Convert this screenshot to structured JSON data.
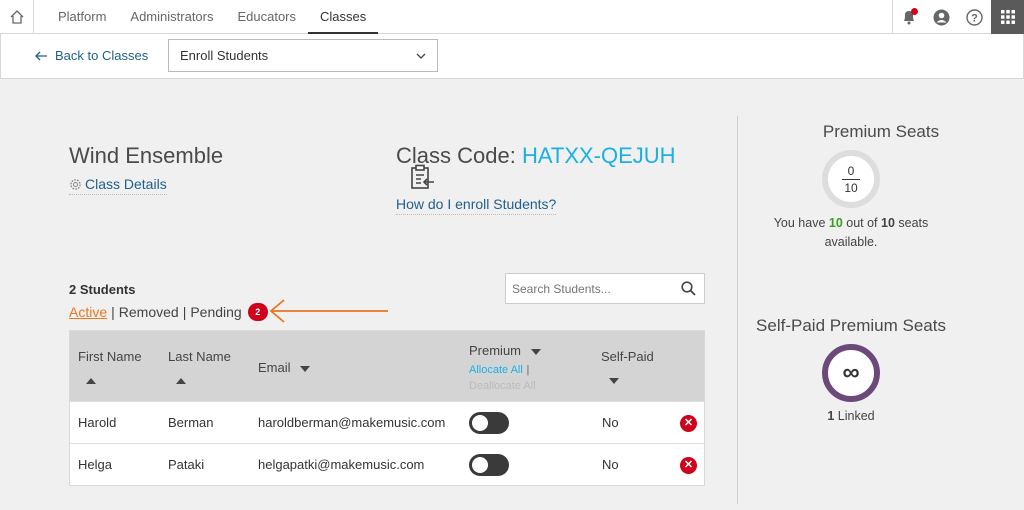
{
  "nav": {
    "tabs": [
      "Platform",
      "Administrators",
      "Educators",
      "Classes"
    ],
    "active_tab": "Classes",
    "icons": [
      "home-icon",
      "bell-icon",
      "account-icon",
      "help-icon",
      "apps-grid-icon"
    ]
  },
  "subbar": {
    "back_label": "Back to Classes",
    "select_value": "Enroll Students"
  },
  "class": {
    "name": "Wind Ensemble",
    "details_label": "Class Details",
    "code_label": "Class Code: ",
    "code": "HATXX-QEJUH",
    "howto": "How do I enroll Students?"
  },
  "students": {
    "count": "2 Students",
    "filter_active": "Active",
    "filter_removed": "Removed",
    "filter_pending": "Pending",
    "pending_count": "2",
    "sep": "|",
    "search_placeholder": "Search Students..."
  },
  "table": {
    "headers": {
      "first": "First Name",
      "last": "Last Name",
      "email": "Email",
      "premium": "Premium",
      "allocate": "Allocate All",
      "deallocate": "Deallocate All",
      "selfpaid": "Self-Paid"
    },
    "rows": [
      {
        "first": "Harold",
        "last": "Berman",
        "email": "haroldberman@makemusic.com",
        "premium": false,
        "selfpaid": "No"
      },
      {
        "first": "Helga",
        "last": "Pataki",
        "email": "helgapatki@makemusic.com",
        "premium": false,
        "selfpaid": "No"
      }
    ]
  },
  "seats": {
    "title": "Premium Seats",
    "used": "0",
    "total": "10",
    "text_pre": "You have ",
    "available": "10",
    "text_mid": " out of ",
    "of_total": "10",
    "text_post": " seats available.",
    "self_title": "Self-Paid Premium Seats",
    "self_symbol": "∞",
    "linked_count": "1",
    "linked_label": " Linked"
  },
  "colors": {
    "accent_orange": "#e87722",
    "code_blue": "#1ab0e6",
    "link_blue": "#1f5f8b",
    "alert_red": "#d0021b",
    "ring_purple": "#6b4a7a"
  }
}
